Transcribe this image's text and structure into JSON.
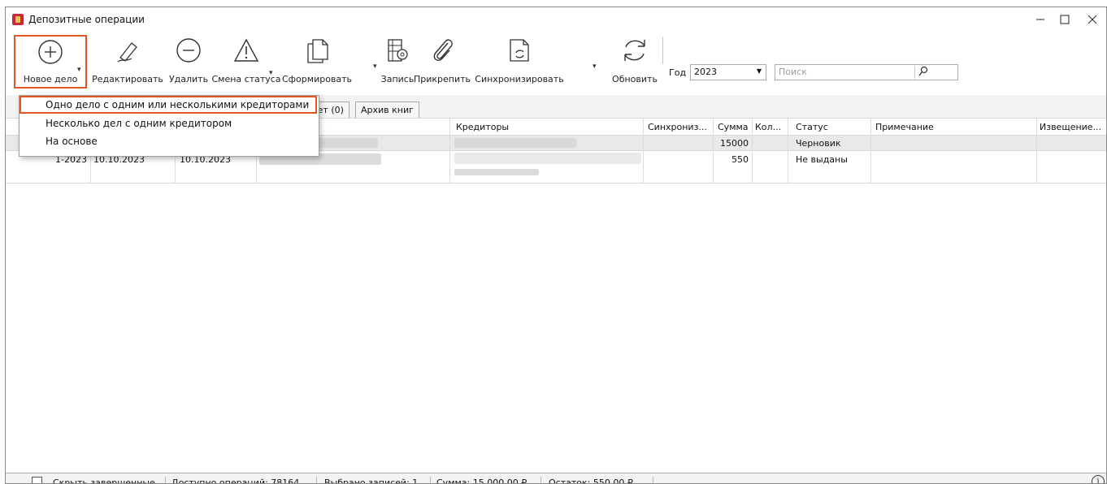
{
  "window": {
    "title": "Депозитные операции"
  },
  "toolbar": {
    "new_case": "Новое дело",
    "edit": "Редактировать",
    "delete": "Удалить",
    "change_status": "Смена статуса",
    "generate": "Сформировать",
    "record": "Запись",
    "attach": "Прикрепить",
    "sync": "Синхронизировать",
    "refresh": "Обновить"
  },
  "filters": {
    "year_label": "Год",
    "year_value": "2023",
    "search_placeholder": "Поиск"
  },
  "dropdown_menu": {
    "items": [
      "Одно дело с одним или несколькими кредиторами",
      "Несколько дел с одним кредитором",
      "На основе"
    ]
  },
  "tabs": [
    "кет (0)",
    "Архив книг"
  ],
  "grid": {
    "columns": {
      "creditors": "Кредиторы",
      "sync": "Синхрониз...",
      "sum": "Сумма",
      "count": "Кол...",
      "status": "Статус",
      "note": "Примечание",
      "notice": "Извещение..."
    },
    "rows": [
      {
        "number": "",
        "date1": "",
        "date2": "",
        "sum": "15000",
        "status": "Черновик"
      },
      {
        "number": "1-2023",
        "date1": "10.10.2023",
        "date2": "10.10.2023",
        "sum": "550",
        "status": "Не выданы"
      }
    ]
  },
  "statusbar": {
    "hide_completed": "Скрыть завершенные",
    "available_ops": "Доступно операций: 78164",
    "selected": "Выбрано записей: 1",
    "sum": "Сумма: 15 000,00 ₽",
    "remainder": "Остаток: 550,00 ₽"
  },
  "colors": {
    "highlight": "#e0561f",
    "selected_row": "#e9e9e9"
  }
}
